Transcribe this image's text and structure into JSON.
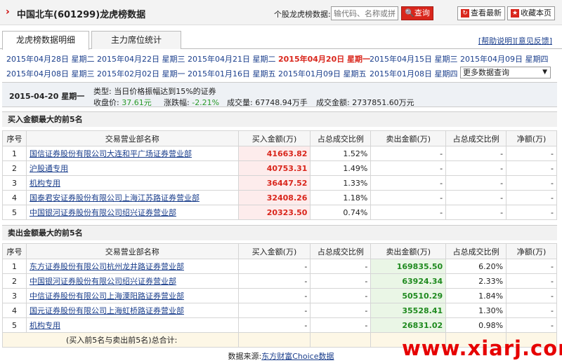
{
  "header": {
    "title": "中国北车(601299)龙虎榜数据",
    "search_label": "个股龙虎榜数据:",
    "search_placeholder": "输代码、名称或拼音",
    "search_btn": "查询",
    "latest_btn": "查看最新",
    "fav_btn": "收藏本页"
  },
  "tabs": [
    {
      "label": "龙虎榜数据明细"
    },
    {
      "label": "主力席位统计"
    }
  ],
  "help": {
    "explain": "[帮助说明]",
    "feedback": "[意见反馈]"
  },
  "dates": [
    "2015年04月28日 星期二",
    "2015年04月22日 星期三",
    "2015年04月21日 星期二",
    "2015年04月20日 星期一",
    "2015年04月15日 星期三",
    "2015年04月09日 星期四",
    "2015年04月08日 星期三",
    "2015年02月02日 星期一",
    "2015年01月16日 星期五",
    "2015年01月09日 星期五",
    "2015年01月08日 星期四"
  ],
  "more_select": "更多数据查询",
  "info": {
    "date": "2015-04-20 星期一",
    "type": "类型: 当日价格振幅达到15%的证券",
    "close_label": "收盘价:",
    "close": "37.61元",
    "change_label": "涨跌幅:",
    "change": "-2.21%",
    "volume": "成交量: 67748.94万手",
    "amount": "成交金额: 2737851.60万元"
  },
  "buy_section": "买入金额最大的前5名",
  "sell_section": "卖出金额最大的前5名",
  "columns": [
    "序号",
    "交易营业部名称",
    "买入金额(万)",
    "占总成交比例",
    "卖出金额(万)",
    "占总成交比例",
    "净额(万)"
  ],
  "buy_rows": [
    {
      "no": "1",
      "name": "国信证券股份有限公司大连和平广场证券营业部",
      "buy": "41663.82",
      "buy_pct": "1.52%",
      "sell": "-",
      "sell_pct": "-",
      "net": "-"
    },
    {
      "no": "2",
      "name": "沪股通专用",
      "buy": "40753.31",
      "buy_pct": "1.49%",
      "sell": "-",
      "sell_pct": "-",
      "net": "-"
    },
    {
      "no": "3",
      "name": "机构专用",
      "buy": "36447.52",
      "buy_pct": "1.33%",
      "sell": "-",
      "sell_pct": "-",
      "net": "-"
    },
    {
      "no": "4",
      "name": "国泰君安证券股份有限公司上海江苏路证券营业部",
      "buy": "32408.26",
      "buy_pct": "1.18%",
      "sell": "-",
      "sell_pct": "-",
      "net": "-"
    },
    {
      "no": "5",
      "name": "中国银河证券股份有限公司绍兴证券营业部",
      "buy": "20323.50",
      "buy_pct": "0.74%",
      "sell": "-",
      "sell_pct": "-",
      "net": "-"
    }
  ],
  "sell_rows": [
    {
      "no": "1",
      "name": "东方证券股份有限公司杭州龙井路证券营业部",
      "buy": "-",
      "buy_pct": "-",
      "sell": "169835.50",
      "sell_pct": "6.20%",
      "net": "-"
    },
    {
      "no": "2",
      "name": "中国银河证券股份有限公司绍兴证券营业部",
      "buy": "-",
      "buy_pct": "-",
      "sell": "63924.34",
      "sell_pct": "2.33%",
      "net": "-"
    },
    {
      "no": "3",
      "name": "中信证券股份有限公司上海溧阳路证券营业部",
      "buy": "-",
      "buy_pct": "-",
      "sell": "50510.29",
      "sell_pct": "1.84%",
      "net": "-"
    },
    {
      "no": "4",
      "name": "国元证券股份有限公司上海虹桥路证券营业部",
      "buy": "-",
      "buy_pct": "-",
      "sell": "35528.41",
      "sell_pct": "1.30%",
      "net": "-"
    },
    {
      "no": "5",
      "name": "机构专用",
      "buy": "-",
      "buy_pct": "-",
      "sell": "26831.02",
      "sell_pct": "0.98%",
      "net": "-"
    }
  ],
  "summary": "(买入前5名与卖出前5名)总合计:",
  "footer": {
    "label": "数据来源:",
    "source": "东方财富Choice数据"
  },
  "watermark": "www.xiarj.com"
}
